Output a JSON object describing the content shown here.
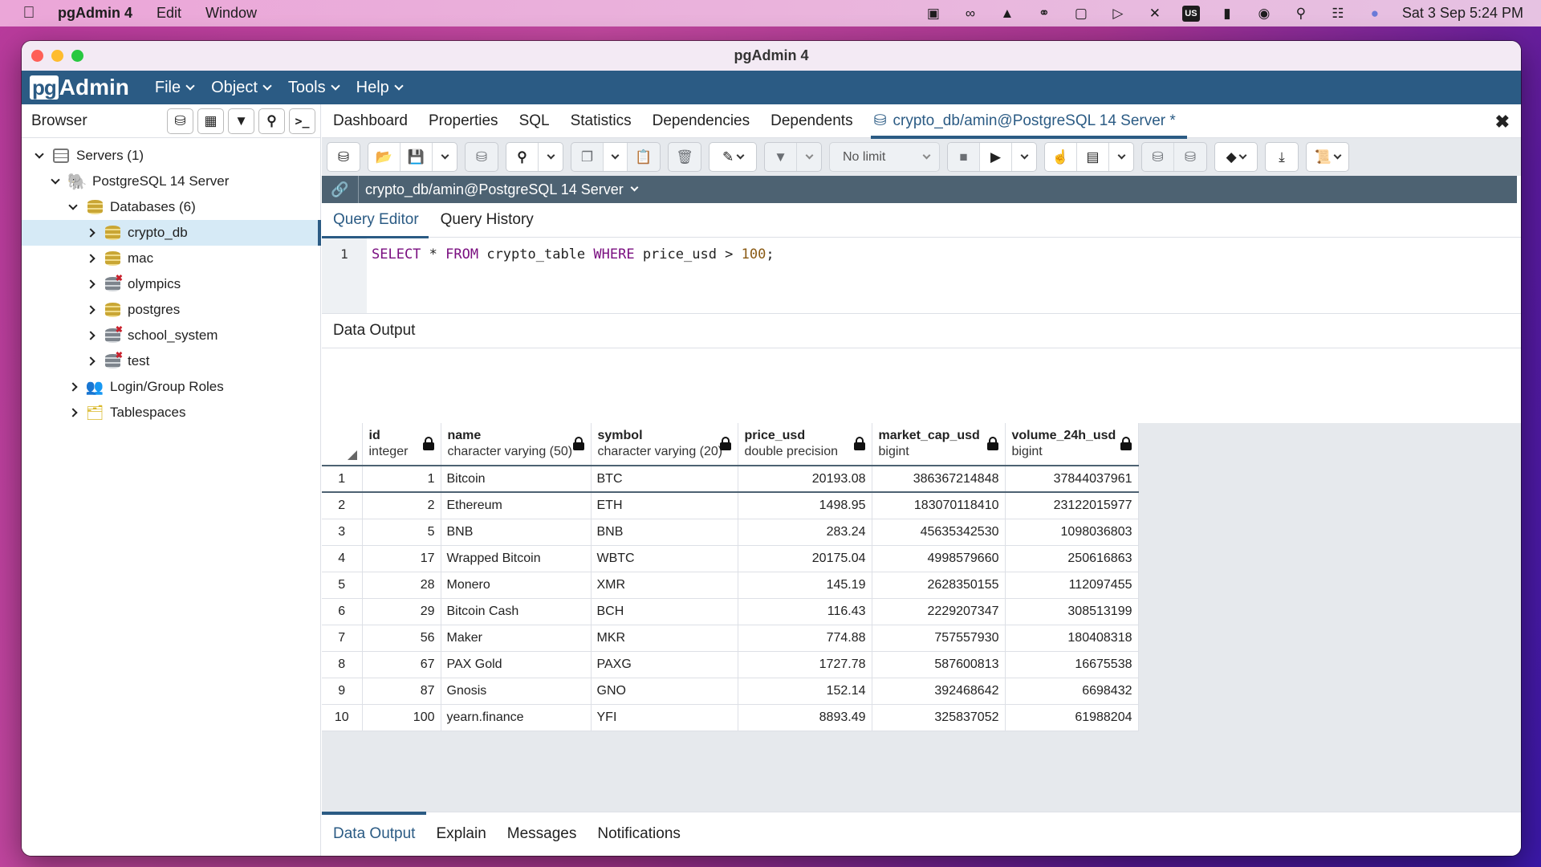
{
  "menubar": {
    "app_name": "pgAdmin 4",
    "items": [
      "Edit",
      "Window"
    ],
    "status_icons": [
      "video-camera-icon",
      "creative-cloud-icon",
      "evernote-icon",
      "torrent-icon",
      "display-icon",
      "play-icon",
      "bluetooth-icon",
      "keyboard-input-icon",
      "battery-icon",
      "wifi-icon",
      "search-icon",
      "control-center-icon",
      "siri-icon"
    ],
    "input_source": "US",
    "clock": "Sat 3 Sep  5:24 PM"
  },
  "window": {
    "title": "pgAdmin 4"
  },
  "app_header": {
    "logo_pg": "pg",
    "logo_admin": "Admin",
    "menus": [
      "File",
      "Object",
      "Tools",
      "Help"
    ]
  },
  "browser": {
    "title": "Browser",
    "tools": [
      "query-tool-icon",
      "view-data-icon",
      "filtered-rows-icon",
      "search-objects-icon",
      "psql-tool-icon"
    ],
    "tree": {
      "servers": "Servers (1)",
      "server": "PostgreSQL 14 Server",
      "databases": "Databases (6)",
      "db_items": [
        {
          "name": "crypto_db",
          "connected": true,
          "selected": true
        },
        {
          "name": "mac",
          "connected": true,
          "selected": false
        },
        {
          "name": "olympics",
          "connected": false,
          "selected": false
        },
        {
          "name": "postgres",
          "connected": true,
          "selected": false
        },
        {
          "name": "school_system",
          "connected": false,
          "selected": false
        },
        {
          "name": "test",
          "connected": false,
          "selected": false
        }
      ],
      "login_roles": "Login/Group Roles",
      "tablespaces": "Tablespaces"
    }
  },
  "main": {
    "object_tabs": [
      "Dashboard",
      "Properties",
      "SQL",
      "Statistics",
      "Dependencies",
      "Dependents"
    ],
    "active_tab": "crypto_db/amin@PostgreSQL 14 Server *",
    "toolbar": {
      "limit": "No limit"
    },
    "connection": "crypto_db/amin@PostgreSQL 14 Server",
    "query_tabs": [
      "Query Editor",
      "Query History"
    ],
    "editor": {
      "line_number": "1",
      "tokens": [
        {
          "t": "SELECT",
          "k": "kw"
        },
        {
          "t": " * ",
          "k": ""
        },
        {
          "t": "FROM",
          "k": "kw"
        },
        {
          "t": " crypto_table ",
          "k": ""
        },
        {
          "t": "WHERE",
          "k": "kw"
        },
        {
          "t": " price_usd > ",
          "k": ""
        },
        {
          "t": "100",
          "k": "num"
        },
        {
          "t": ";",
          "k": ""
        }
      ]
    },
    "data_output_label": "Data Output",
    "bottom_tabs": [
      "Data Output",
      "Explain",
      "Messages",
      "Notifications"
    ]
  },
  "grid": {
    "columns": [
      {
        "name": "id",
        "type": "integer",
        "align": "r"
      },
      {
        "name": "name",
        "type": "character varying (50)",
        "align": "l"
      },
      {
        "name": "symbol",
        "type": "character varying (20)",
        "align": "l"
      },
      {
        "name": "price_usd",
        "type": "double precision",
        "align": "r"
      },
      {
        "name": "market_cap_usd",
        "type": "bigint",
        "align": "r"
      },
      {
        "name": "volume_24h_usd",
        "type": "bigint",
        "align": "r"
      }
    ],
    "rows": [
      [
        "1",
        "Bitcoin",
        "BTC",
        "20193.08",
        "386367214848",
        "37844037961"
      ],
      [
        "2",
        "Ethereum",
        "ETH",
        "1498.95",
        "183070118410",
        "23122015977"
      ],
      [
        "5",
        "BNB",
        "BNB",
        "283.24",
        "45635342530",
        "1098036803"
      ],
      [
        "17",
        "Wrapped Bitcoin",
        "WBTC",
        "20175.04",
        "4998579660",
        "250616863"
      ],
      [
        "28",
        "Monero",
        "XMR",
        "145.19",
        "2628350155",
        "112097455"
      ],
      [
        "29",
        "Bitcoin Cash",
        "BCH",
        "116.43",
        "2229207347",
        "308513199"
      ],
      [
        "56",
        "Maker",
        "MKR",
        "774.88",
        "757557930",
        "180408318"
      ],
      [
        "67",
        "PAX Gold",
        "PAXG",
        "1727.78",
        "587600813",
        "16675538"
      ],
      [
        "87",
        "Gnosis",
        "GNO",
        "152.14",
        "392468642",
        "6698432"
      ],
      [
        "100",
        "yearn.finance",
        "YFI",
        "8893.49",
        "325837052",
        "61988204"
      ]
    ]
  }
}
